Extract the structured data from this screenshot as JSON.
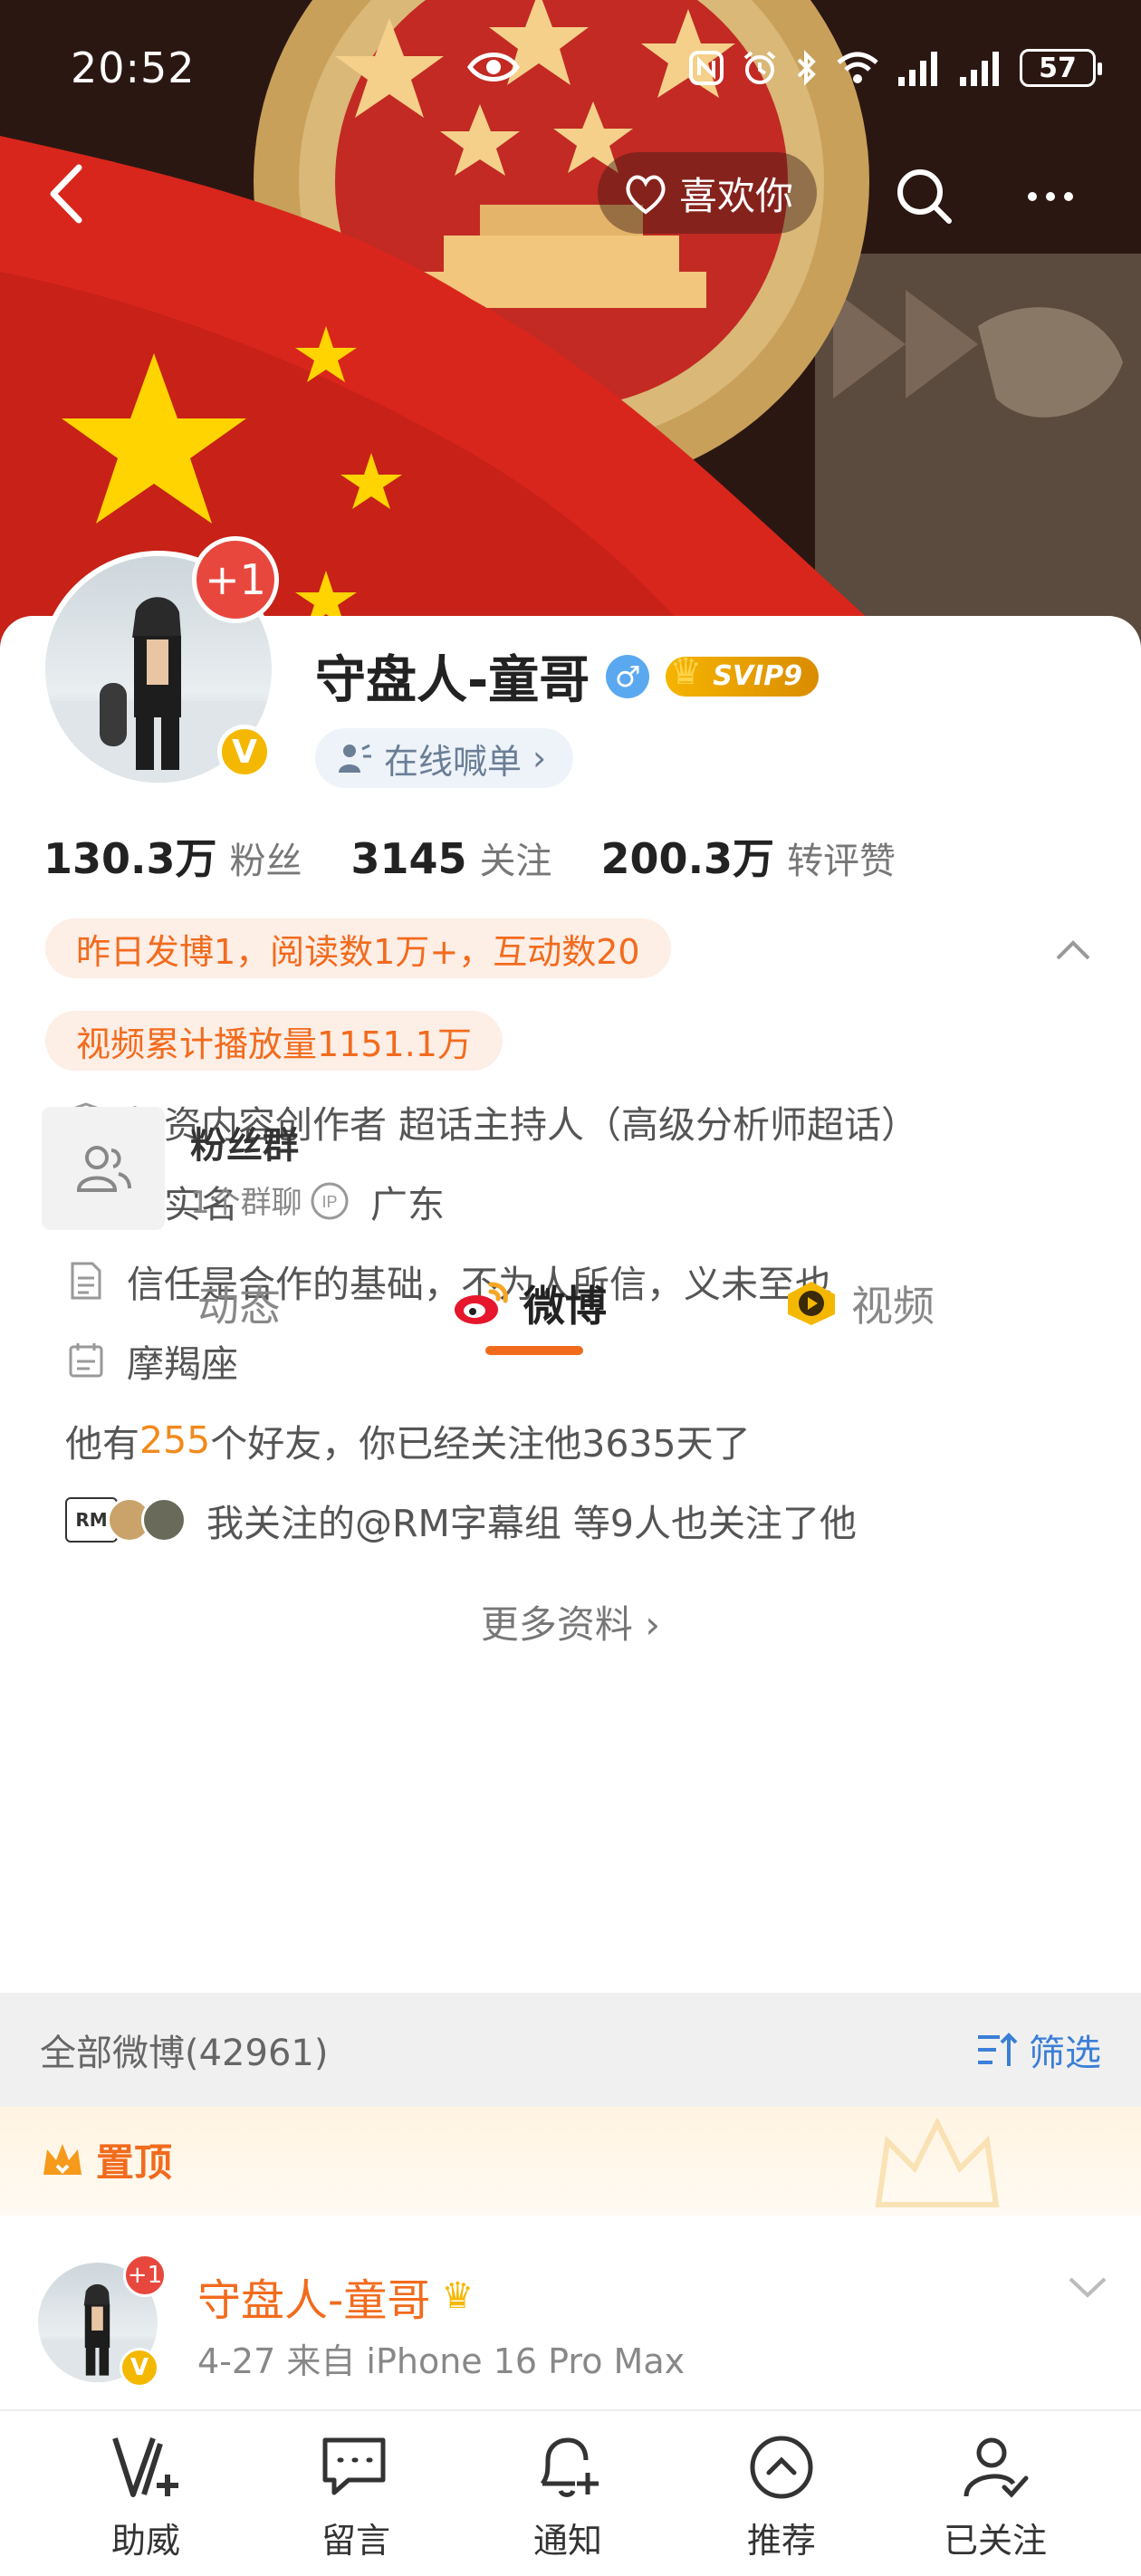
{
  "status": {
    "time": "20:52",
    "battery": "57"
  },
  "nav": {
    "like_label": "喜欢你"
  },
  "profile": {
    "plus_badge": "+1",
    "name": "守盘人-童哥",
    "svip": "SVIP9",
    "shout": "在线喊单",
    "stats": [
      {
        "num": "130.3万",
        "label": "粉丝"
      },
      {
        "num": "3145",
        "label": "关注"
      },
      {
        "num": "200.3万",
        "label": "转评赞"
      }
    ],
    "tags": [
      "昨日发博1，阅读数1万+，互动数20",
      "视频累计播放量1151.1万"
    ],
    "info": {
      "creator": "投资内容创作者 超话主持人（高级分析师超话）",
      "verified": "已实名",
      "ip": "广东",
      "bio": "信任是合作的基础，不为人所信，义未至也",
      "zodiac": "摩羯座",
      "friends_prefix": "他有 ",
      "friends_count": "255",
      "friends_suffix": " 个好友，你已经关注他3635天了",
      "common_follow": "我关注的@RM字幕组 等9人也关注了他"
    },
    "more_info": "更多资料"
  },
  "fan_group": {
    "title": "粉丝群",
    "sub": "1个群聊"
  },
  "tabs": {
    "feed": "动态",
    "weibo": "微博",
    "video": "视频"
  },
  "feed": {
    "count_label": "全部微博(42961)",
    "filter_label": "筛选",
    "pinned_label": "置顶",
    "post": {
      "name": "守盘人-童哥",
      "meta": "4-27   来自 iPhone 16 Pro Max"
    }
  },
  "bottombar": [
    "助威",
    "留言",
    "通知",
    "推荐",
    "已关注"
  ],
  "colors": {
    "accent": "#f26b1d",
    "link": "#3b7fd6",
    "svip": "#f6b400"
  }
}
